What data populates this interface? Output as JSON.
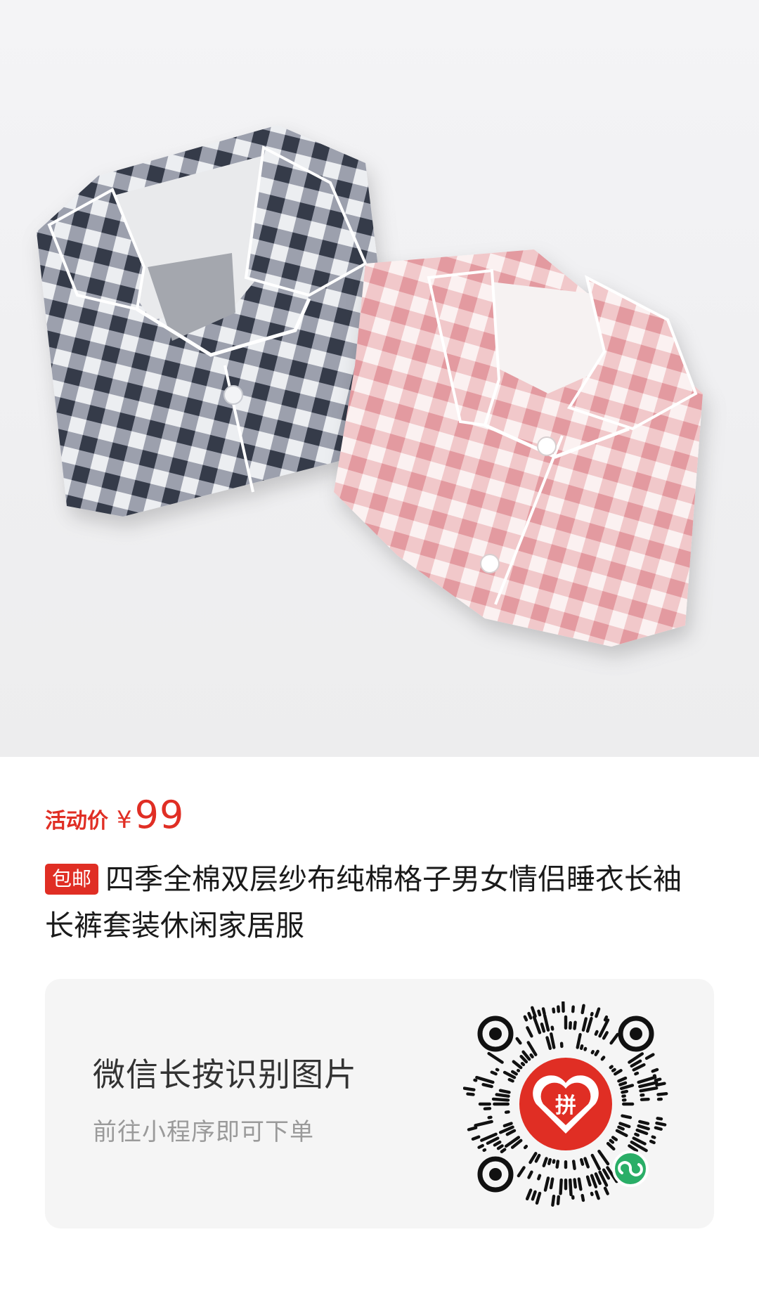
{
  "product": {
    "image_alt": "Two folded gingham pajama shirts, navy and pink",
    "price_label": "活动价",
    "currency": "¥",
    "price": "99",
    "badge": "包邮",
    "title": "四季全棉双层纱布纯棉格子男女情侣睡衣长袖长裤套装休闲家居服"
  },
  "miniprogram": {
    "title": "微信长按识别图片",
    "subtitle": "前往小程序即可下单"
  },
  "colors": {
    "accent": "#e02e24",
    "navy_check": "#3b4150",
    "pink_check": "#e8a9ae",
    "wechat_green": "#2aae67"
  }
}
